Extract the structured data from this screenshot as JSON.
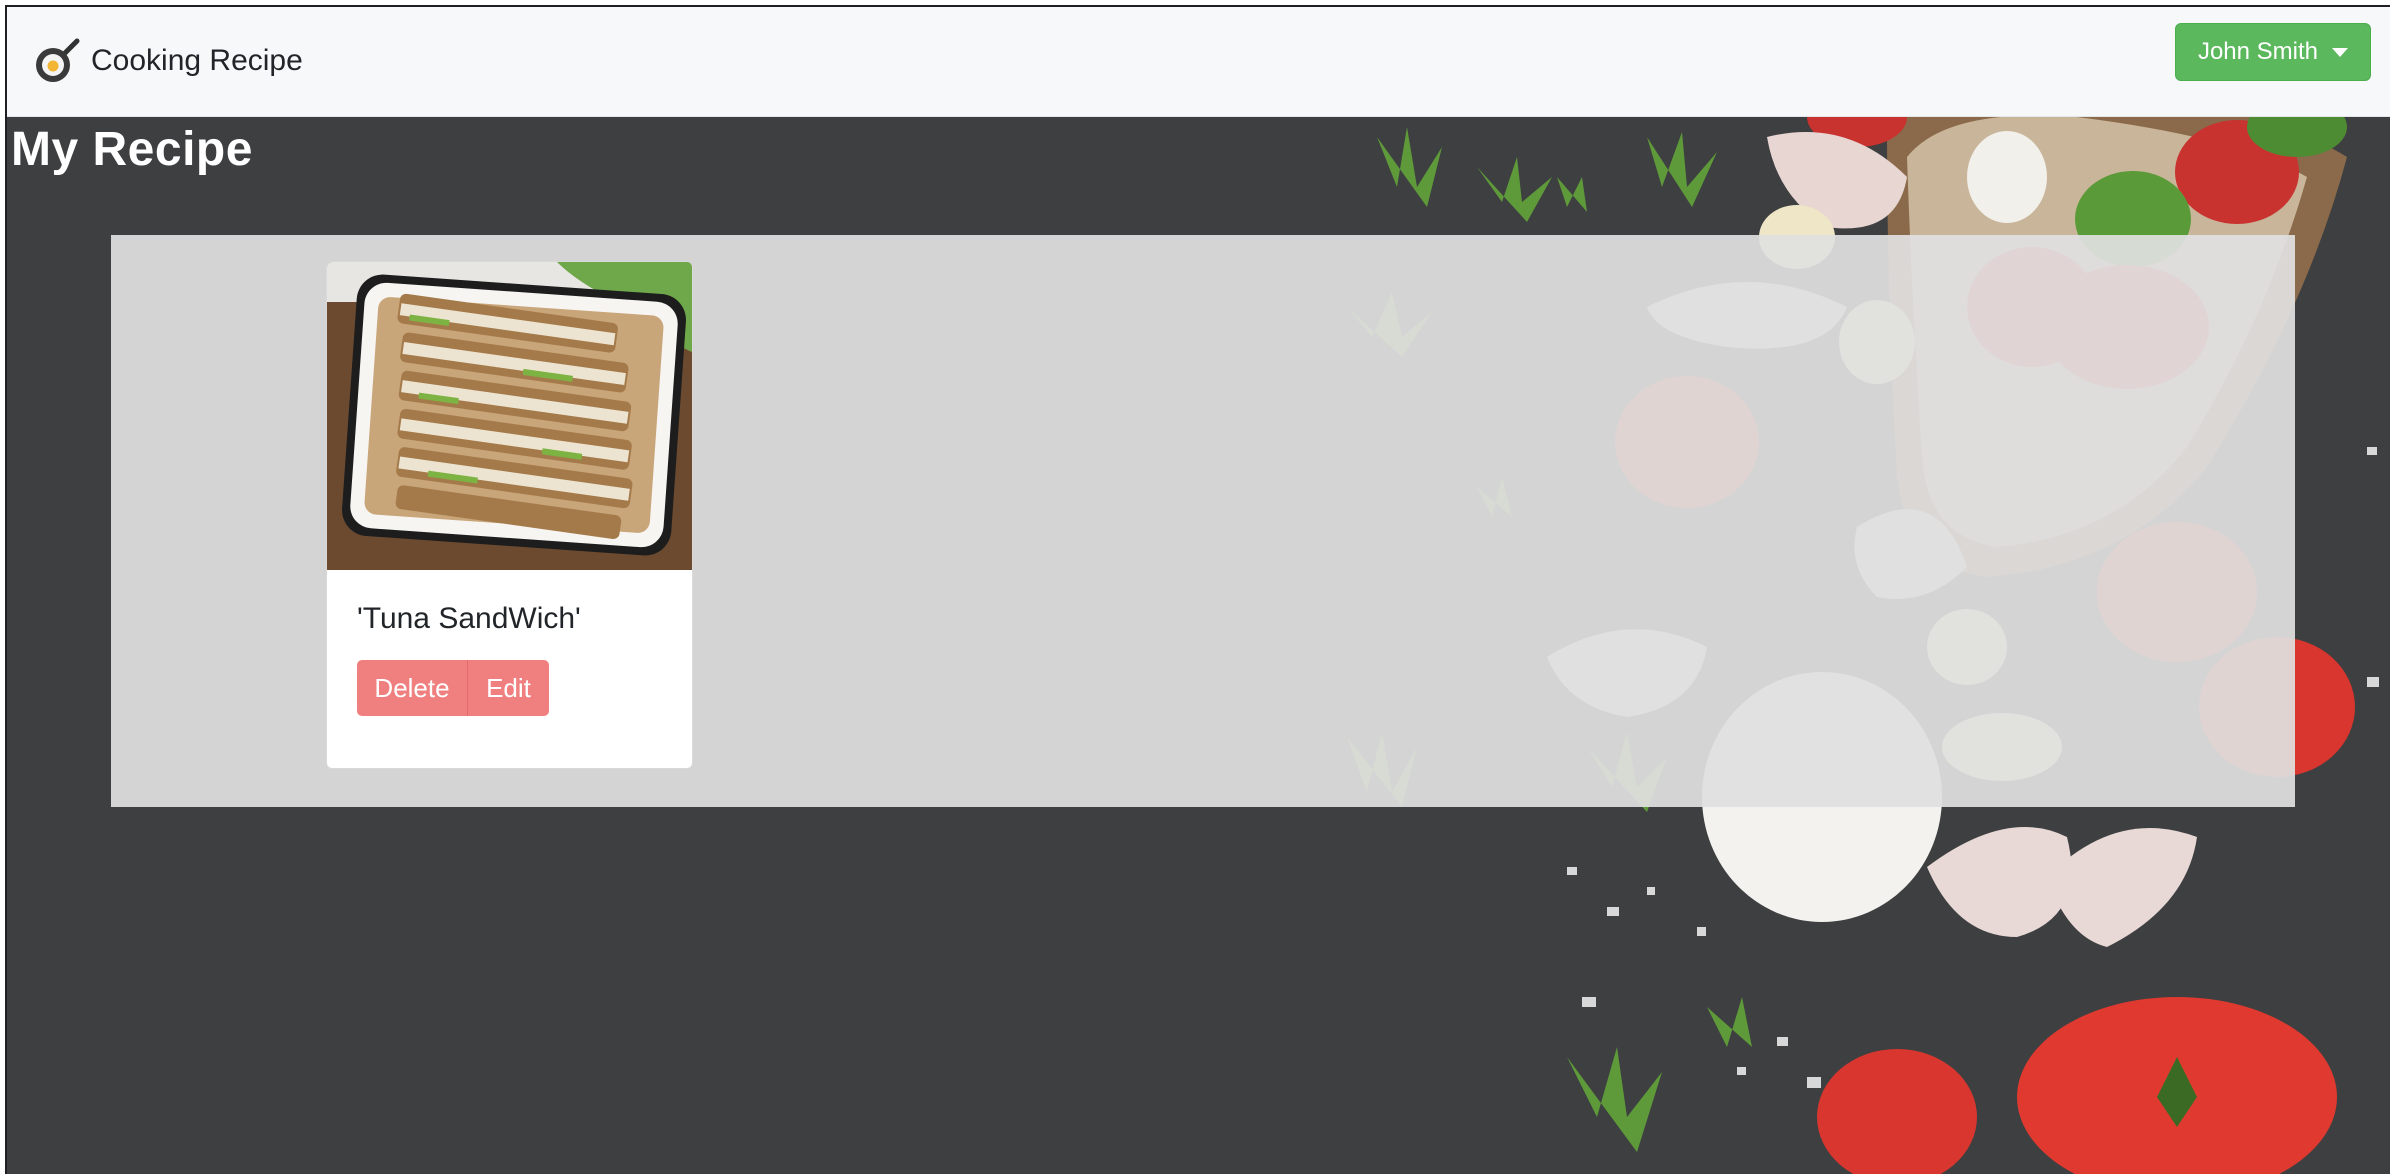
{
  "navbar": {
    "brand_text": "Cooking Recipe",
    "brand_icon": "frying-pan-egg-icon",
    "user_menu_label": "John Smith",
    "user_menu_color": "#5cb85c"
  },
  "page": {
    "title": "My Recipe",
    "background_color": "#3e3f41"
  },
  "recipes": [
    {
      "title": "'Tuna SandWich'",
      "image": "tuna-sandwich-photo",
      "delete_label": "Delete",
      "edit_label": "Edit",
      "button_color": "#f08080"
    }
  ]
}
